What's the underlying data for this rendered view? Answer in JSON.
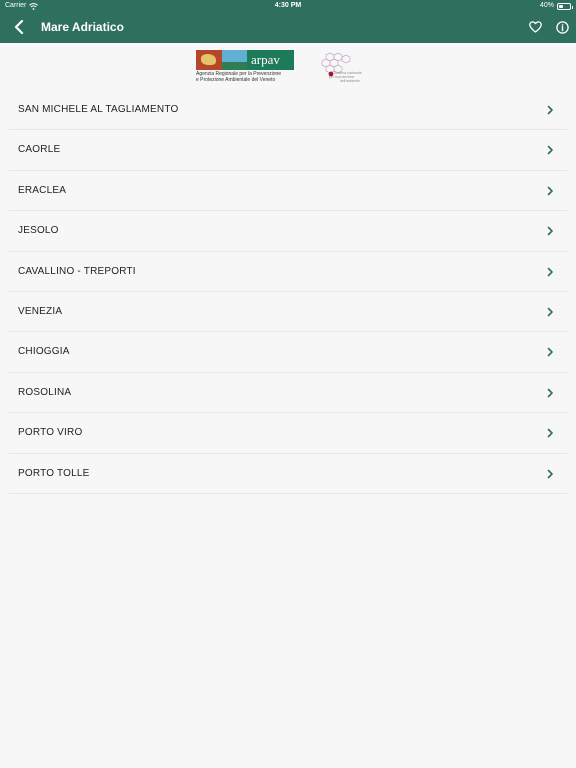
{
  "status_bar": {
    "carrier": "Carrier",
    "time": "4:30 PM",
    "battery": "40%",
    "battery_level": 0.4
  },
  "nav": {
    "title": "Mare Adriatico",
    "back_icon": "chevron-left-icon",
    "favorite_icon": "heart-icon",
    "info_icon": "info-icon"
  },
  "logos": {
    "arpav_name": "arpav",
    "arpav_line1": "Agenzia Regionale per la Prevenzione",
    "arpav_line2": "e Protezione Ambientale del Veneto",
    "network_line1": "Sistema nazionale",
    "network_line2": "per la protezione",
    "network_line3": "dell'ambiente"
  },
  "colors": {
    "header": "#2e6f5d",
    "chevron": "#2e6f5d",
    "background": "#f7f7f7"
  },
  "locations": [
    {
      "label": "SAN MICHELE AL TAGLIAMENTO"
    },
    {
      "label": "CAORLE"
    },
    {
      "label": "ERACLEA"
    },
    {
      "label": "JESOLO"
    },
    {
      "label": "CAVALLINO - TREPORTI"
    },
    {
      "label": "VENEZIA"
    },
    {
      "label": "CHIOGGIA"
    },
    {
      "label": "ROSOLINA"
    },
    {
      "label": "PORTO VIRO"
    },
    {
      "label": "PORTO TOLLE"
    }
  ]
}
